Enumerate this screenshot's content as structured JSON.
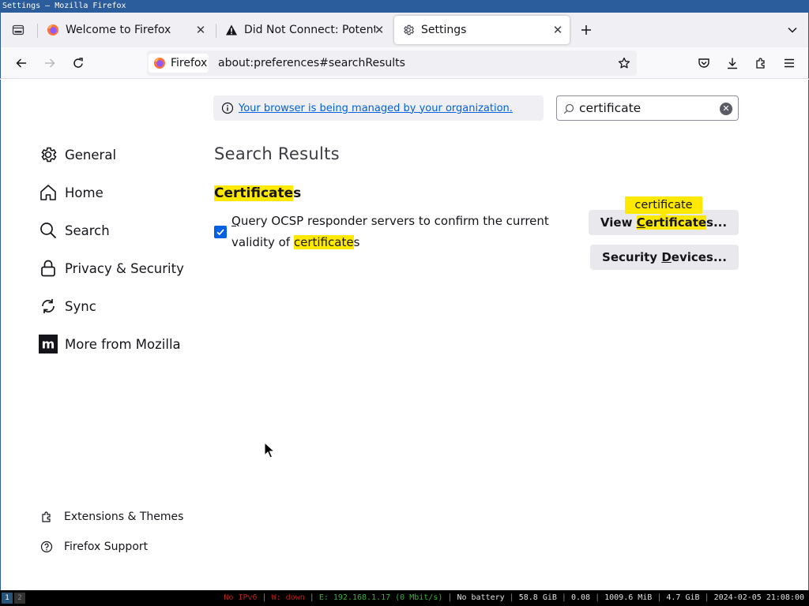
{
  "window": {
    "title": "Settings — Mozilla Firefox"
  },
  "tabs": [
    {
      "label": "Welcome to Firefox",
      "icon": "firefox-logo-icon",
      "selected": false
    },
    {
      "label": "Did Not Connect: Potenti",
      "icon": "warning-icon",
      "selected": false
    },
    {
      "label": "Settings",
      "icon": "gear-icon",
      "selected": true
    }
  ],
  "navbar": {
    "identity_label": "Firefox",
    "url": "about:preferences#searchResults"
  },
  "policies_notice": {
    "link_text": "Your browser is being managed by your organization."
  },
  "search": {
    "value": "certificate"
  },
  "sidebar": {
    "items": [
      {
        "label": "General",
        "icon": "gear-icon"
      },
      {
        "label": "Home",
        "icon": "home-icon"
      },
      {
        "label": "Search",
        "icon": "search-icon"
      },
      {
        "label": "Privacy & Security",
        "icon": "lock-icon"
      },
      {
        "label": "Sync",
        "icon": "sync-icon"
      },
      {
        "label": "More from Mozilla",
        "icon": "mozilla-icon"
      }
    ],
    "footer": [
      {
        "label": "Extensions & Themes",
        "icon": "puzzle-icon"
      },
      {
        "label": "Firefox Support",
        "icon": "help-icon"
      }
    ]
  },
  "main": {
    "heading": "Search Results",
    "group": {
      "title_match": "Certificate",
      "title_rest": "s"
    },
    "ocsp": {
      "checked": true,
      "label_part1_underlined": "Q",
      "label_part1": "uery OCSP responder servers to confirm the current validity of ",
      "label_match": "certificate",
      "label_end": "s"
    },
    "view_certificates": {
      "prefix": "View ",
      "accesskey": "C",
      "match_rest": "ertificate",
      "suffix": "s..."
    },
    "security_devices": {
      "prefix": "Security ",
      "accesskey": "D",
      "suffix": "evices..."
    },
    "tooltip": "certificate"
  },
  "statusbar": {
    "workspaces": [
      "1",
      "2"
    ],
    "segments": [
      {
        "text": "No IPv6",
        "color": "#b2251c"
      },
      {
        "text": "W: down",
        "color": "#b2251c"
      },
      {
        "text": "E: 192.168.1.17 (0 Mbit/s)",
        "color": "#3bb33b"
      },
      {
        "text": "No battery",
        "color": "#e0e0e0"
      },
      {
        "text": "58.8 GiB",
        "color": "#e0e0e0"
      },
      {
        "text": "0.08",
        "color": "#e0e0e0"
      },
      {
        "text": "1009.6 MiB",
        "color": "#e0e0e0"
      },
      {
        "text": "4.7 GiB",
        "color": "#e0e0e0"
      },
      {
        "text": "2024-02-05 21:08:00",
        "color": "#e0e0e0"
      }
    ]
  },
  "colors": {
    "accent": "#0061e0",
    "highlight": "#ffe900",
    "titlebar": "#2b5c9b"
  }
}
